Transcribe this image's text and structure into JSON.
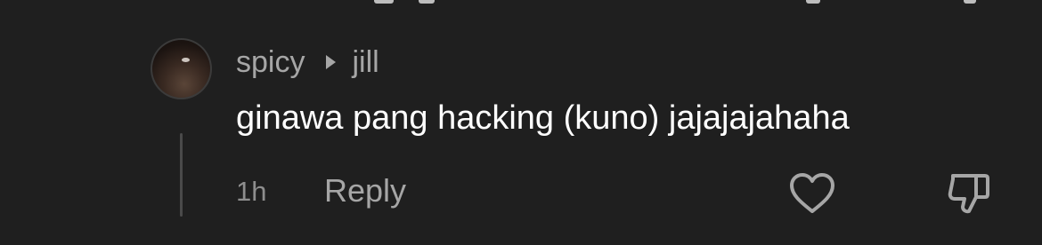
{
  "comment": {
    "author": "spicy",
    "reply_to": "jill",
    "text": "ginawa pang hacking (kuno) jajajajahaha",
    "time": "1h",
    "reply_label": "Reply"
  },
  "icons": {
    "like": "heart-icon",
    "dislike": "thumbs-down-icon",
    "reply_arrow": "caret-right-icon"
  },
  "colors": {
    "background": "#1f1f1f",
    "text_primary": "#ffffff",
    "text_secondary": "#a6a6a6",
    "thread_line": "#4a4a4a"
  }
}
